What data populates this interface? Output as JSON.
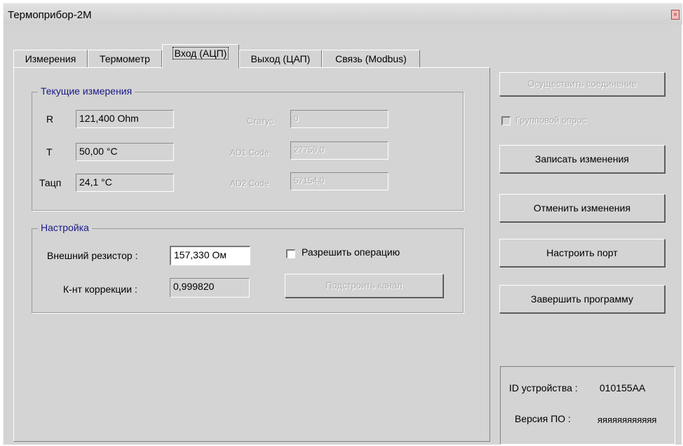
{
  "window": {
    "title": "Термоприбор-2М"
  },
  "tabs": [
    {
      "label": "Измерения",
      "active": false
    },
    {
      "label": "Термометр",
      "active": false
    },
    {
      "label": "Вход (АЦП)",
      "active": true
    },
    {
      "label": "Выход (ЦАП)",
      "active": false
    },
    {
      "label": "Связь (Modbus)",
      "active": false
    }
  ],
  "current": {
    "title": "Текущие измерения",
    "r_label": "R",
    "r_value": "121,400  Ohm",
    "t_label": "T",
    "t_value": "50,00  °C",
    "tcj_label": "Тацп",
    "tcj_value": "24,1  °C",
    "status_label": "Статус",
    "status_value": "0",
    "ad1_label": "AD1 Code",
    "ad1_value": "27759,0",
    "ad2_label": "AD2 Code",
    "ad2_value": "57154,0"
  },
  "setup": {
    "title": "Настройка",
    "resistor_label": "Внешний резистор :",
    "resistor_value": "157,330  Ом",
    "allow_label": "Разрешить операцию",
    "coef_label": "К-нт коррекции :",
    "coef_value": "0,999820",
    "tune_button": "Подстроить канал"
  },
  "side": {
    "connect_button": "Осуществить соединение",
    "group_poll_label": "Групповой опрос",
    "save_button": "Записать изменения",
    "cancel_button": "Отменить изменения",
    "port_button": "Настроить порт",
    "exit_button": "Завершить программу",
    "device_id_label": "ID устройства :",
    "device_id_value": "010155AA",
    "version_label": "Версия ПО :",
    "version_value": "яяяяяяяяяяяя"
  }
}
